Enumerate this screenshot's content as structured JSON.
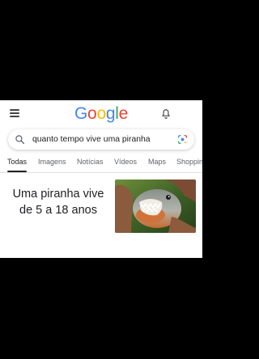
{
  "header": {
    "logo_letters": [
      "G",
      "o",
      "o",
      "g",
      "l",
      "e"
    ],
    "logo_colors": [
      "#4285F4",
      "#EA4335",
      "#FBBC05",
      "#4285F4",
      "#34A853",
      "#EA4335"
    ],
    "menu_icon": "hamburger-menu-icon",
    "notifications_icon": "bell-icon"
  },
  "search": {
    "query": "quanto tempo vive uma piranha",
    "search_icon": "search-icon",
    "lens_icon": "google-lens-icon"
  },
  "tabs": [
    {
      "label": "Todas",
      "active": true
    },
    {
      "label": "Imagens",
      "active": false
    },
    {
      "label": "Notícias",
      "active": false
    },
    {
      "label": "Vídeos",
      "active": false
    },
    {
      "label": "Maps",
      "active": false
    },
    {
      "label": "Shopping",
      "active": false
    }
  ],
  "featured_answer": {
    "text": "Uma piranha vive de 5 a 18 anos",
    "image": "piranha-held-in-hand-photo"
  },
  "colors": {
    "text_primary": "#202124",
    "text_secondary": "#5f6368",
    "background": "#ffffff"
  }
}
